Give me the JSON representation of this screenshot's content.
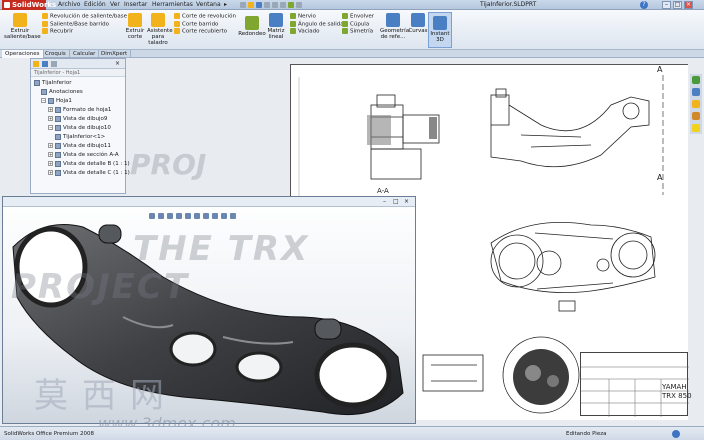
{
  "app": {
    "logo_text": "SolidWorks",
    "window_title": "TijaInferior.SLDPRT",
    "menu": [
      "Archivo",
      "Edición",
      "Ver",
      "Insertar",
      "Herramientas",
      "Ventana"
    ],
    "menu_overflow": "▸"
  },
  "ribbon": {
    "extruir_saliente": "Extruir saliente/base",
    "revolucion_saliente": "Revolución de saliente/base",
    "saliente_barrido": "Saliente/Base barrido",
    "recubrir": "Recubrir",
    "extruir_corte": "Extruir corte",
    "asistente_taladro": "Asistente para taladro",
    "corte_revolucion": "Corte de revolución",
    "corte_barrido": "Corte barrido",
    "corte_recubierto": "Corte recubierto",
    "redondeo": "Redondeo",
    "matriz_lineal": "Matriz lineal",
    "nervio": "Nervio",
    "angulo_salida": "Ángulo de salida",
    "vaciado": "Vaciado",
    "envolver": "Envolver",
    "cupula": "Cúpula",
    "simetria": "Simetría",
    "geometria_ref": "Geometría de refe...",
    "curvas": "Curvas",
    "instant3d": "Instant 3D"
  },
  "tabs": [
    "Operaciones",
    "Croquis",
    "Calcular",
    "DimXpert"
  ],
  "active_tab": 0,
  "tree": {
    "header": "TijaInferior",
    "breadcrumb": "TijaInferior - Hoja1",
    "nodes": [
      {
        "label": "TijaInferior",
        "indent": 0,
        "toggle": ""
      },
      {
        "label": "Anotaciones",
        "indent": 1,
        "toggle": ""
      },
      {
        "label": "Hoja1",
        "indent": 1,
        "toggle": "−"
      },
      {
        "label": "Formato de hoja1",
        "indent": 2,
        "toggle": "+"
      },
      {
        "label": "Vista de dibujo9",
        "indent": 2,
        "toggle": "+"
      },
      {
        "label": "Vista de dibujo10",
        "indent": 2,
        "toggle": "−"
      },
      {
        "label": "TijaInferior<1>",
        "indent": 3,
        "toggle": ""
      },
      {
        "label": "Vista de dibujo11",
        "indent": 2,
        "toggle": "+"
      },
      {
        "label": "Vista de sección A-A",
        "indent": 2,
        "toggle": "+"
      },
      {
        "label": "Vista de detalle B (1 : 1)",
        "indent": 2,
        "toggle": "+"
      },
      {
        "label": "Vista de detalle C (1 : 1)",
        "indent": 2,
        "toggle": "+"
      }
    ]
  },
  "drawing": {
    "section_label_top": "A",
    "section_label_mid": "A",
    "section_caption": "A-A",
    "titleblock_brand": "YAMAH",
    "titleblock_model": "TRX 850"
  },
  "watermarks": {
    "the": "THE TRX",
    "project": "PROJECT",
    "project2": "PROJ",
    "cn": "莫西网",
    "url": "www.3dmox.com"
  },
  "status": {
    "left": "SolidWorks Office Premium 2008",
    "right": "Editando Pieza",
    "help": "?"
  },
  "colors": {
    "accent": "#4a7fc4",
    "logo_red": "#c52a1e"
  }
}
